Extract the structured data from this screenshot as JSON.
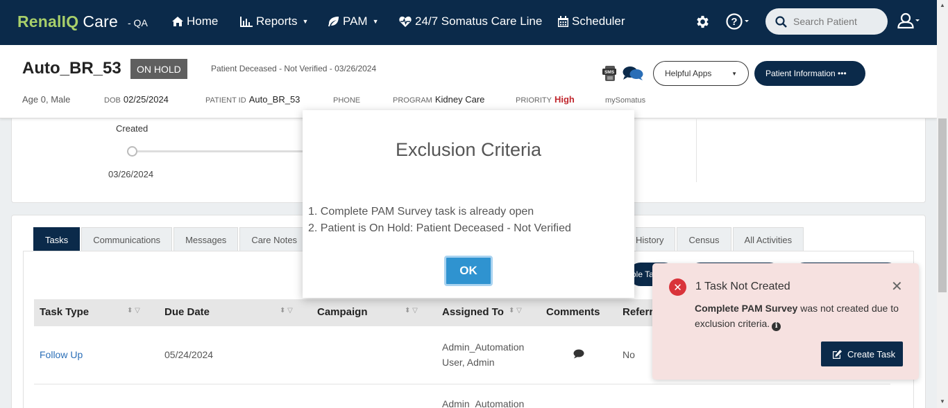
{
  "navbar": {
    "brand_renal": "Renal",
    "brand_iq": "IQ",
    "brand_care": "Care",
    "env": "- QA",
    "items": [
      {
        "label": "Home",
        "icon": "home-icon"
      },
      {
        "label": "Reports",
        "icon": "bar-chart-icon"
      },
      {
        "label": "PAM",
        "icon": "leaf-icon"
      },
      {
        "label": "24/7 Somatus Care Line",
        "icon": "heartbeat-icon"
      },
      {
        "label": "Scheduler",
        "icon": "calendar-icon"
      }
    ],
    "search_placeholder": "Search Patient"
  },
  "patient": {
    "name": "Auto_BR_53",
    "status_badge": "ON HOLD",
    "deceased_note": "Patient Deceased - Not Verified - 03/26/2024",
    "age_sex": "Age 0, Male",
    "dob_label": "DOB",
    "dob": "02/25/2024",
    "patient_id_label": "PATIENT ID",
    "patient_id": "Auto_BR_53",
    "phone_label": "PHONE",
    "program_label": "PROGRAM",
    "program": "Kidney Care",
    "priority_label": "PRIORITY",
    "priority": "High",
    "my_somatus": "mySomatus",
    "helpful_apps": "Helpful Apps",
    "patient_info_button": "Patient Information •••"
  },
  "timeline": {
    "stage": "Created",
    "date": "03/26/2024"
  },
  "tabs": [
    "Tasks",
    "Communications",
    "Messages",
    "Care Notes",
    "History",
    "Census",
    "All Activities"
  ],
  "tasks_table": {
    "columns": [
      "Task Type",
      "Due Date",
      "Campaign",
      "Assigned To",
      "Comments",
      "Referr"
    ],
    "rows": [
      {
        "task_type": "Follow Up",
        "due_date": "05/24/2024",
        "campaign": "",
        "assigned_to_1": "Admin_Automation",
        "assigned_to_2": "User, Admin",
        "referral": "No"
      },
      {
        "task_type": "",
        "due_date": "",
        "campaign": "",
        "assigned_to_1": "Admin_Automation",
        "assigned_to_2": "",
        "referral": ""
      }
    ],
    "partial_button": "ple Ta"
  },
  "modal": {
    "title": "Exclusion Criteria",
    "items": [
      "1. Complete PAM Survey task is already open",
      "2. Patient is On Hold: Patient Deceased - Not Verified"
    ],
    "ok_label": "OK"
  },
  "toast": {
    "title": "1 Task Not Created",
    "body_bold": "Complete PAM Survey",
    "body_rest": " was not created due to exclusion criteria.",
    "create_task_label": "Create Task"
  },
  "colors": {
    "navy": "#0b2a4a",
    "brand_green": "#a8cf6a",
    "ok_blue": "#2f93d0",
    "error_red": "#d9333a",
    "priority_red": "#c0272d"
  }
}
